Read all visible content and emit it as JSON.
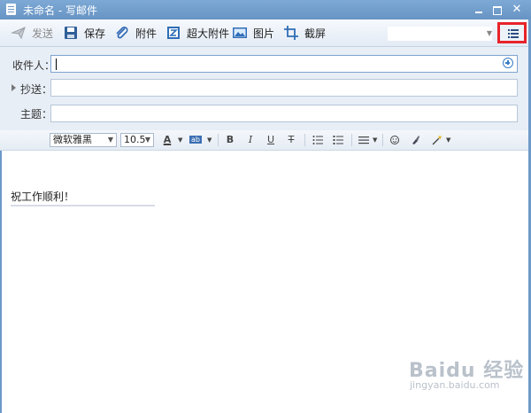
{
  "window": {
    "title": "未命名 - 写邮件",
    "minimize": "–",
    "maximize": "□",
    "close": "✕"
  },
  "toolbar": {
    "send_label": "发送",
    "save_label": "保存",
    "attach_label": "附件",
    "big_attach_label": "超大附件",
    "image_label": "图片",
    "screenshot_label": "截屏"
  },
  "fields": {
    "to_label": "收件人：",
    "cc_label": "抄送：",
    "subject_label": "主题："
  },
  "format": {
    "font_family": "微软雅黑",
    "font_size": "10.5",
    "font_color_glyph": "A",
    "highlight_glyph": "ab",
    "bold": "B",
    "italic": "I",
    "underline": "U",
    "strike": "T"
  },
  "body": {
    "text": "祝工作顺利！"
  },
  "watermark": {
    "main": "Baidu 经验",
    "sub": "jingyan.baidu.com"
  },
  "colors": {
    "window_frame": "#6d9ac9",
    "highlight_box": "#e8232a"
  }
}
